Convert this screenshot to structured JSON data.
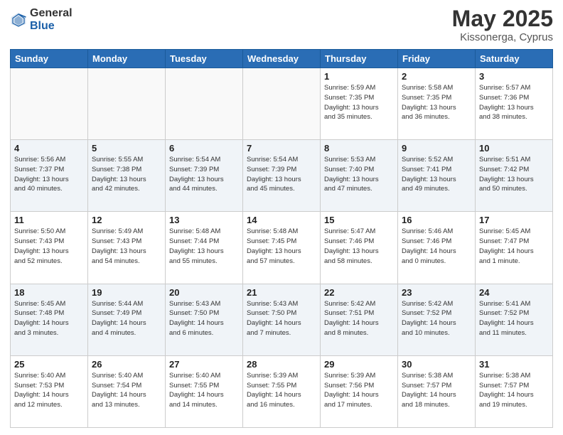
{
  "header": {
    "logo_general": "General",
    "logo_blue": "Blue",
    "month_year": "May 2025",
    "location": "Kissonerga, Cyprus"
  },
  "days_of_week": [
    "Sunday",
    "Monday",
    "Tuesday",
    "Wednesday",
    "Thursday",
    "Friday",
    "Saturday"
  ],
  "weeks": [
    [
      {
        "day": "",
        "info": ""
      },
      {
        "day": "",
        "info": ""
      },
      {
        "day": "",
        "info": ""
      },
      {
        "day": "",
        "info": ""
      },
      {
        "day": "1",
        "info": "Sunrise: 5:59 AM\nSunset: 7:35 PM\nDaylight: 13 hours\nand 35 minutes."
      },
      {
        "day": "2",
        "info": "Sunrise: 5:58 AM\nSunset: 7:35 PM\nDaylight: 13 hours\nand 36 minutes."
      },
      {
        "day": "3",
        "info": "Sunrise: 5:57 AM\nSunset: 7:36 PM\nDaylight: 13 hours\nand 38 minutes."
      }
    ],
    [
      {
        "day": "4",
        "info": "Sunrise: 5:56 AM\nSunset: 7:37 PM\nDaylight: 13 hours\nand 40 minutes."
      },
      {
        "day": "5",
        "info": "Sunrise: 5:55 AM\nSunset: 7:38 PM\nDaylight: 13 hours\nand 42 minutes."
      },
      {
        "day": "6",
        "info": "Sunrise: 5:54 AM\nSunset: 7:39 PM\nDaylight: 13 hours\nand 44 minutes."
      },
      {
        "day": "7",
        "info": "Sunrise: 5:54 AM\nSunset: 7:39 PM\nDaylight: 13 hours\nand 45 minutes."
      },
      {
        "day": "8",
        "info": "Sunrise: 5:53 AM\nSunset: 7:40 PM\nDaylight: 13 hours\nand 47 minutes."
      },
      {
        "day": "9",
        "info": "Sunrise: 5:52 AM\nSunset: 7:41 PM\nDaylight: 13 hours\nand 49 minutes."
      },
      {
        "day": "10",
        "info": "Sunrise: 5:51 AM\nSunset: 7:42 PM\nDaylight: 13 hours\nand 50 minutes."
      }
    ],
    [
      {
        "day": "11",
        "info": "Sunrise: 5:50 AM\nSunset: 7:43 PM\nDaylight: 13 hours\nand 52 minutes."
      },
      {
        "day": "12",
        "info": "Sunrise: 5:49 AM\nSunset: 7:43 PM\nDaylight: 13 hours\nand 54 minutes."
      },
      {
        "day": "13",
        "info": "Sunrise: 5:48 AM\nSunset: 7:44 PM\nDaylight: 13 hours\nand 55 minutes."
      },
      {
        "day": "14",
        "info": "Sunrise: 5:48 AM\nSunset: 7:45 PM\nDaylight: 13 hours\nand 57 minutes."
      },
      {
        "day": "15",
        "info": "Sunrise: 5:47 AM\nSunset: 7:46 PM\nDaylight: 13 hours\nand 58 minutes."
      },
      {
        "day": "16",
        "info": "Sunrise: 5:46 AM\nSunset: 7:46 PM\nDaylight: 14 hours\nand 0 minutes."
      },
      {
        "day": "17",
        "info": "Sunrise: 5:45 AM\nSunset: 7:47 PM\nDaylight: 14 hours\nand 1 minute."
      }
    ],
    [
      {
        "day": "18",
        "info": "Sunrise: 5:45 AM\nSunset: 7:48 PM\nDaylight: 14 hours\nand 3 minutes."
      },
      {
        "day": "19",
        "info": "Sunrise: 5:44 AM\nSunset: 7:49 PM\nDaylight: 14 hours\nand 4 minutes."
      },
      {
        "day": "20",
        "info": "Sunrise: 5:43 AM\nSunset: 7:50 PM\nDaylight: 14 hours\nand 6 minutes."
      },
      {
        "day": "21",
        "info": "Sunrise: 5:43 AM\nSunset: 7:50 PM\nDaylight: 14 hours\nand 7 minutes."
      },
      {
        "day": "22",
        "info": "Sunrise: 5:42 AM\nSunset: 7:51 PM\nDaylight: 14 hours\nand 8 minutes."
      },
      {
        "day": "23",
        "info": "Sunrise: 5:42 AM\nSunset: 7:52 PM\nDaylight: 14 hours\nand 10 minutes."
      },
      {
        "day": "24",
        "info": "Sunrise: 5:41 AM\nSunset: 7:52 PM\nDaylight: 14 hours\nand 11 minutes."
      }
    ],
    [
      {
        "day": "25",
        "info": "Sunrise: 5:40 AM\nSunset: 7:53 PM\nDaylight: 14 hours\nand 12 minutes."
      },
      {
        "day": "26",
        "info": "Sunrise: 5:40 AM\nSunset: 7:54 PM\nDaylight: 14 hours\nand 13 minutes."
      },
      {
        "day": "27",
        "info": "Sunrise: 5:40 AM\nSunset: 7:55 PM\nDaylight: 14 hours\nand 14 minutes."
      },
      {
        "day": "28",
        "info": "Sunrise: 5:39 AM\nSunset: 7:55 PM\nDaylight: 14 hours\nand 16 minutes."
      },
      {
        "day": "29",
        "info": "Sunrise: 5:39 AM\nSunset: 7:56 PM\nDaylight: 14 hours\nand 17 minutes."
      },
      {
        "day": "30",
        "info": "Sunrise: 5:38 AM\nSunset: 7:57 PM\nDaylight: 14 hours\nand 18 minutes."
      },
      {
        "day": "31",
        "info": "Sunrise: 5:38 AM\nSunset: 7:57 PM\nDaylight: 14 hours\nand 19 minutes."
      }
    ]
  ]
}
